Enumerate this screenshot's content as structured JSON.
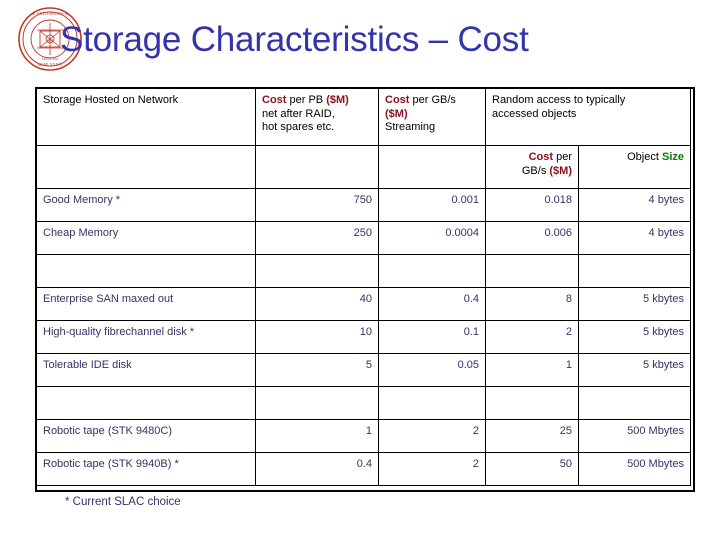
{
  "slide": {
    "title": "Storage Characteristics – Cost",
    "title_color": "#3333AA",
    "logo_name": "university-seal-logo",
    "logo_color": "#C0392B",
    "footnote": "* Current SLAC choice"
  },
  "colors": {
    "cost_highlight": "#8B0F1E",
    "size_highlight": "#0A7A0A",
    "number_text": "#7B1A1A",
    "size_text": "#107010",
    "label_text": "#333366"
  },
  "table": {
    "header_row_1": {
      "col1": "Storage Hosted on Network",
      "col2_part1": "Cost",
      "col2_part2": " per PB ",
      "col2_part3": "($M)",
      "col2_line2": "net after RAID,",
      "col2_line3": "hot spares etc.",
      "col3_part1": "Cost",
      "col3_part2": " per GB/s",
      "col3_part3": "($M)",
      "col3_line3": "Streaming",
      "col4_line1": "Random access to typically",
      "col4_line2": "accessed objects"
    },
    "header_row_2": {
      "col4_part1": "Cost",
      "col4_part2": " per",
      "col4_line2_a": "GB/s ",
      "col4_line2_b": "($M)",
      "col5_part1": "Object ",
      "col5_part2": "Size"
    },
    "rows": [
      {
        "type": "data",
        "label": "Good Memory *",
        "cost_pb": "750",
        "cost_gbs": "0.001",
        "random_access": "0.018",
        "object_size": "4 bytes"
      },
      {
        "type": "data",
        "label": "Cheap Memory",
        "cost_pb": "250",
        "cost_gbs": "0.0004",
        "random_access": "0.006",
        "object_size": "4 bytes"
      },
      {
        "type": "spacer",
        "label": "",
        "cost_pb": "",
        "cost_gbs": "",
        "random_access": "",
        "object_size": ""
      },
      {
        "type": "data",
        "label": "Enterprise SAN maxed out",
        "cost_pb": "40",
        "cost_gbs": "0.4",
        "random_access": "8",
        "object_size": "5 kbytes"
      },
      {
        "type": "data",
        "label": "High-quality fibrechannel disk *",
        "cost_pb": "10",
        "cost_gbs": "0.1",
        "random_access": "2",
        "object_size": "5 kbytes"
      },
      {
        "type": "data",
        "label": "Tolerable IDE disk",
        "cost_pb": "5",
        "cost_gbs": "0.05",
        "random_access": "1",
        "object_size": "5 kbytes"
      },
      {
        "type": "spacer",
        "label": "",
        "cost_pb": "",
        "cost_gbs": "",
        "random_access": "",
        "object_size": ""
      },
      {
        "type": "data",
        "label": "Robotic tape (STK 9480C)",
        "cost_pb": "1",
        "cost_gbs": "2",
        "random_access": "25",
        "object_size": "500 Mbytes"
      },
      {
        "type": "data",
        "label": "Robotic tape (STK 9940B) *",
        "cost_pb": "0.4",
        "cost_gbs": "2",
        "random_access": "50",
        "object_size": "500 Mbytes"
      }
    ]
  }
}
